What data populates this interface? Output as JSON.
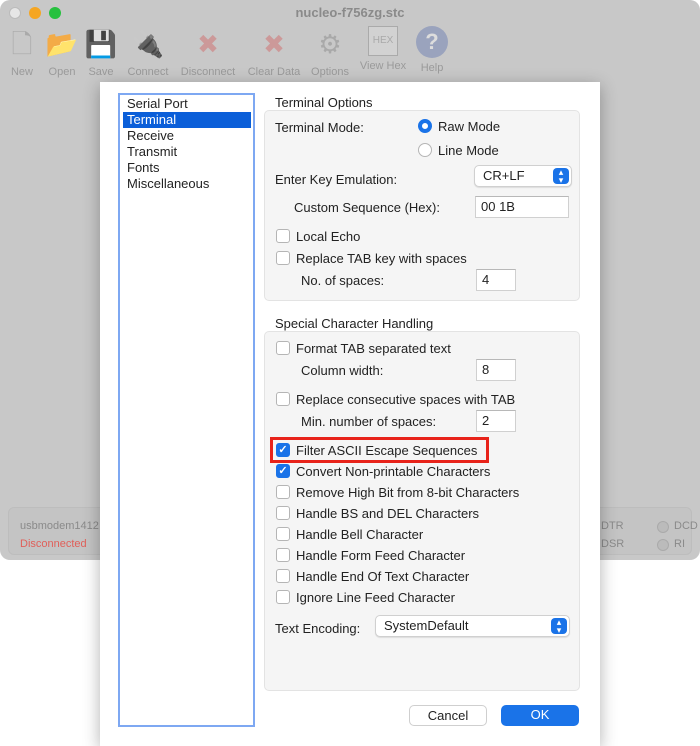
{
  "window": {
    "title": "nucleo-f756zg.stc"
  },
  "toolbar": [
    {
      "label": "New",
      "icon": "new-file-icon"
    },
    {
      "label": "Open",
      "icon": "open-folder-icon"
    },
    {
      "label": "Save",
      "icon": "floppy-disk-icon"
    },
    {
      "label": "Connect",
      "icon": "usb-plug-icon"
    },
    {
      "label": "Disconnect",
      "icon": "usb-disconnect-icon"
    },
    {
      "label": "Clear Data",
      "icon": "red-x-icon"
    },
    {
      "label": "Options",
      "icon": "gears-icon"
    },
    {
      "label": "View Hex",
      "icon": "hex-icon",
      "glyph": "HEX"
    },
    {
      "label": "Help",
      "icon": "help-icon",
      "glyph": "?"
    }
  ],
  "status": {
    "port": "usbmodem1412",
    "state": "Disconnected",
    "state_color": "#e0605a",
    "signals": [
      "DTR",
      "DCD",
      "DSR",
      "RI"
    ]
  },
  "sidebar": {
    "items": [
      "Serial Port",
      "Terminal",
      "Receive",
      "Transmit",
      "Fonts",
      "Miscellaneous"
    ],
    "selected": "Terminal"
  },
  "terminal_options": {
    "title": "Terminal Options",
    "mode_label": "Terminal Mode:",
    "modes": [
      {
        "label": "Raw Mode",
        "selected": true
      },
      {
        "label": "Line Mode",
        "selected": false
      }
    ],
    "enter_key_label": "Enter Key Emulation:",
    "enter_key_value": "CR+LF",
    "custom_seq_label": "Custom Sequence (Hex):",
    "custom_seq_value": "00 1B",
    "local_echo": {
      "label": "Local Echo",
      "checked": false
    },
    "replace_tab": {
      "label": "Replace TAB key with spaces",
      "checked": false
    },
    "spaces_label": "No. of spaces:",
    "spaces_value": "4"
  },
  "special": {
    "title": "Special Character Handling",
    "format_tab": {
      "label": "Format TAB separated text",
      "checked": false
    },
    "column_width_label": "Column width:",
    "column_width_value": "8",
    "replace_spaces": {
      "label": "Replace consecutive spaces with TAB",
      "checked": false
    },
    "min_spaces_label": "Min. number of spaces:",
    "min_spaces_value": "2",
    "checks": [
      {
        "label": "Filter ASCII Escape Sequences",
        "checked": true,
        "highlighted": true
      },
      {
        "label": "Convert Non-printable Characters",
        "checked": true
      },
      {
        "label": "Remove High Bit from 8-bit Characters",
        "checked": false
      },
      {
        "label": "Handle BS and DEL Characters",
        "checked": false
      },
      {
        "label": "Handle Bell Character",
        "checked": false
      },
      {
        "label": "Handle Form Feed Character",
        "checked": false
      },
      {
        "label": "Handle End Of Text Character",
        "checked": false
      },
      {
        "label": "Ignore Line Feed Character",
        "checked": false
      }
    ],
    "encoding_label": "Text Encoding:",
    "encoding_value": "SystemDefault"
  },
  "buttons": {
    "cancel": "Cancel",
    "ok": "OK"
  },
  "colors": {
    "accent": "#1a73e8",
    "highlight": "#e8231a"
  }
}
